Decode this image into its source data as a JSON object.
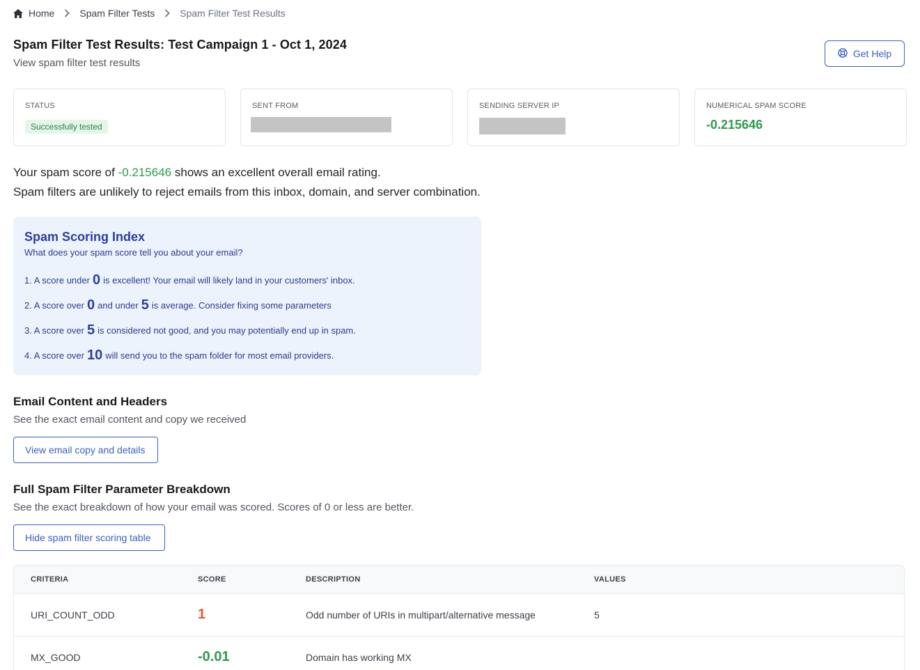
{
  "breadcrumb": {
    "home": "Home",
    "tests": "Spam Filter Tests",
    "current": "Spam Filter Test Results"
  },
  "header": {
    "title": "Spam Filter Test Results: Test Campaign 1 - Oct 1, 2024",
    "subtitle": "View spam filter test results",
    "help_label": "Get Help"
  },
  "cards": {
    "status_label": "STATUS",
    "status_value": "Successfully tested",
    "sent_from_label": "SENT FROM",
    "server_ip_label": "SENDING SERVER IP",
    "score_label": "NUMERICAL SPAM SCORE",
    "score_value": "-0.215646"
  },
  "summary": {
    "line1_prefix": "Your spam score of ",
    "score": "-0.215646",
    "line1_suffix": " shows an excellent overall email rating.",
    "line2": "Spam filters are unlikely to reject emails from this inbox, domain, and server combination."
  },
  "scoring_index": {
    "title": "Spam Scoring Index",
    "subtitle": "What does your spam score tell you about your email?",
    "items": [
      {
        "pre": "1. A score under",
        "n1": "0",
        "mid": "is excellent! Your email will likely land in your customers' inbox.",
        "n2": "",
        "post": ""
      },
      {
        "pre": "2. A score over",
        "n1": "0",
        "mid": "and under",
        "n2": "5",
        "post": "is average. Consider fixing some parameters"
      },
      {
        "pre": "3. A score over",
        "n1": "5",
        "mid": "is considered not good, and you may potentially end up in spam.",
        "n2": "",
        "post": ""
      },
      {
        "pre": "4. A score over",
        "n1": "10",
        "mid": "will send you to the spam folder for most email providers.",
        "n2": "",
        "post": ""
      }
    ]
  },
  "email_content": {
    "title": "Email Content and Headers",
    "subtitle": "See the exact email content and copy we received",
    "button": "View email copy and details"
  },
  "breakdown": {
    "title": "Full Spam Filter Parameter Breakdown",
    "subtitle": "See the exact breakdown of how your email was scored. Scores of 0 or less are better.",
    "button": "Hide spam filter scoring table",
    "columns": [
      "CRITERIA",
      "SCORE",
      "DESCRIPTION",
      "VALUES"
    ],
    "rows": [
      {
        "criteria": "URI_COUNT_ODD",
        "score": "1",
        "description": "Odd number of URIs in multipart/alternative message",
        "values": "5"
      },
      {
        "criteria": "MX_GOOD",
        "score": "-0.01",
        "description": "Domain has working MX",
        "values": ""
      }
    ]
  },
  "colors": {
    "accent": "#3b5fc7",
    "good": "#2e9a4e",
    "bad": "#e05a2a",
    "index_bg": "#edf3fd"
  }
}
